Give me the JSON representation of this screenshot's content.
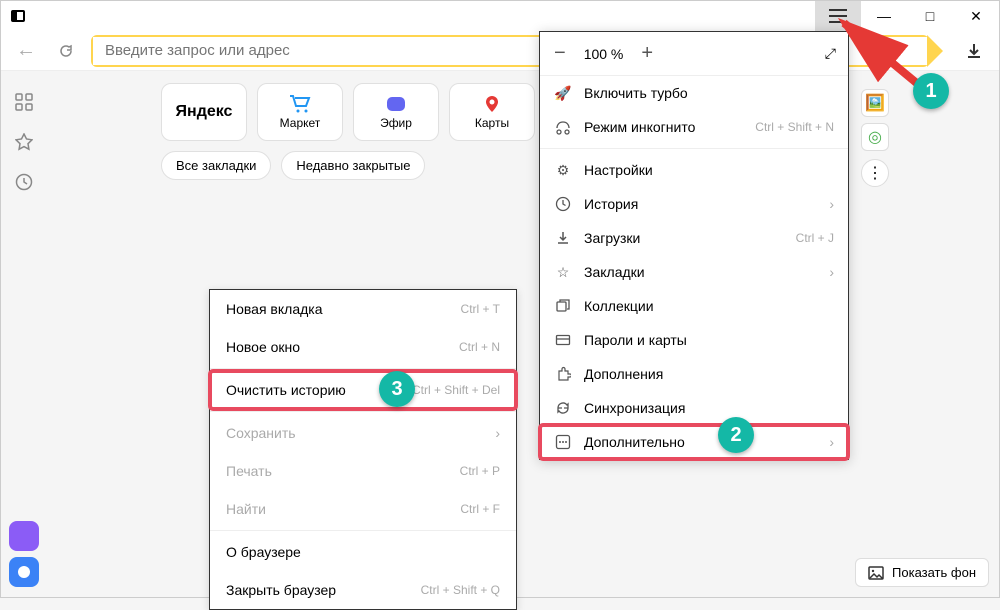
{
  "titlebar": {
    "minimize": "—",
    "maximize": "□",
    "close": "✕"
  },
  "addressbar": {
    "placeholder": "Введите запрос или адрес"
  },
  "tiles": [
    {
      "label": "Яндекс"
    },
    {
      "label": "Маркет"
    },
    {
      "label": "Эфир"
    },
    {
      "label": "Карты"
    }
  ],
  "bookmark_tabs": {
    "all": "Все закладки",
    "recent": "Недавно закрытые"
  },
  "mainmenu": {
    "zoom": {
      "minus": "−",
      "value": "100 %",
      "plus": "+"
    },
    "turbo": "Включить турбо",
    "incognito": "Режим инкогнито",
    "incognito_shortcut": "Ctrl + Shift + N",
    "settings": "Настройки",
    "history": "История",
    "downloads": "Загрузки",
    "downloads_shortcut": "Ctrl + J",
    "bookmarks": "Закладки",
    "collections": "Коллекции",
    "passwords": "Пароли и карты",
    "extensions": "Дополнения",
    "sync": "Синхронизация",
    "more": "Дополнительно"
  },
  "submenu": {
    "new_tab": "Новая вкладка",
    "new_tab_shortcut": "Ctrl + T",
    "new_window": "Новое окно",
    "new_window_shortcut": "Ctrl + N",
    "clear_history": "Очистить историю",
    "clear_history_shortcut": "Ctrl + Shift + Del",
    "save": "Сохранить",
    "print": "Печать",
    "print_shortcut": "Ctrl + P",
    "find": "Найти",
    "find_shortcut": "Ctrl + F",
    "about": "О браузере",
    "close": "Закрыть браузер",
    "close_shortcut": "Ctrl + Shift + Q"
  },
  "show_bg": "Показать фон",
  "badges": {
    "one": "1",
    "two": "2",
    "three": "3"
  }
}
